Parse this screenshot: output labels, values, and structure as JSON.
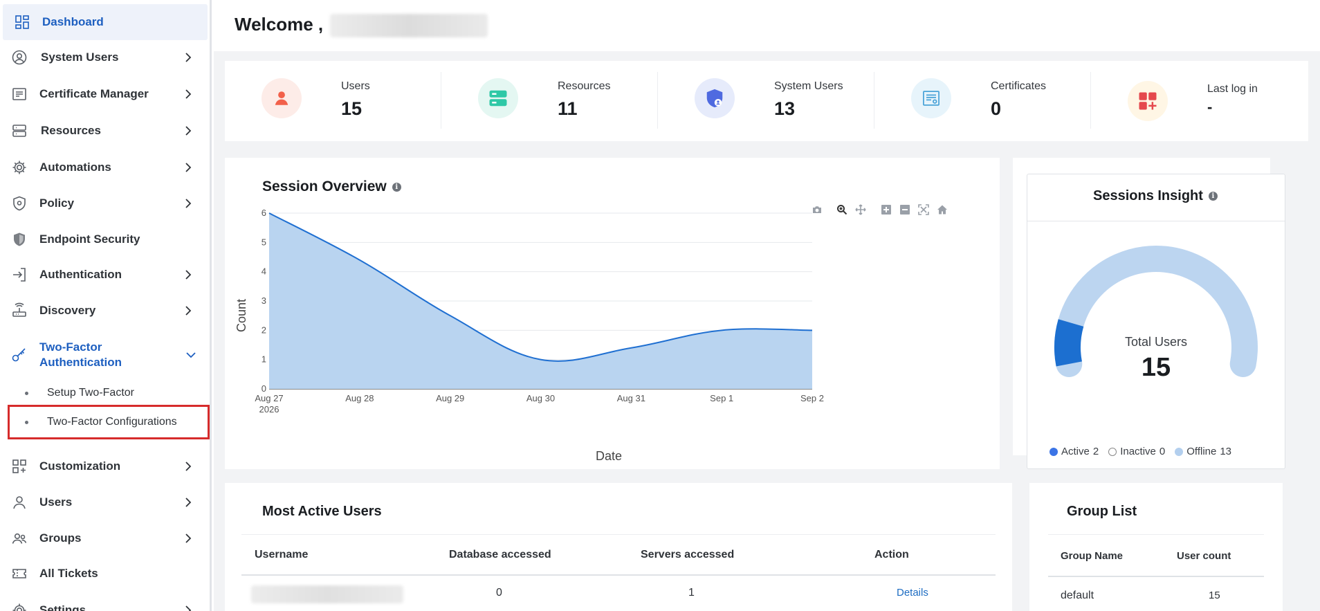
{
  "sidebar": {
    "items": [
      {
        "label": "Dashboard",
        "icon": "grid-icon"
      },
      {
        "label": "System Users",
        "icon": "user-circle-icon"
      },
      {
        "label": "Certificate Manager",
        "icon": "certificate-icon"
      },
      {
        "label": "Resources",
        "icon": "server-icon"
      },
      {
        "label": "Automations",
        "icon": "gear-icon"
      },
      {
        "label": "Policy",
        "icon": "shield-lock-icon"
      },
      {
        "label": "Endpoint Security",
        "icon": "shield-icon"
      },
      {
        "label": "Authentication",
        "icon": "login-icon"
      },
      {
        "label": "Discovery",
        "icon": "router-icon"
      },
      {
        "label": "Two-Factor\nAuthentication",
        "label_line1": "Two-Factor",
        "label_line2": "Authentication",
        "icon": "key-icon"
      },
      {
        "label": "Customization",
        "icon": "apps-add-icon"
      },
      {
        "label": "Users",
        "icon": "user-icon"
      },
      {
        "label": "Groups",
        "icon": "group-icon"
      },
      {
        "label": "All Tickets",
        "icon": "ticket-icon"
      },
      {
        "label": "Settings",
        "icon": "gear-icon"
      }
    ],
    "sub_items": [
      {
        "label": "Setup Two-Factor"
      },
      {
        "label": "Two-Factor Configurations"
      }
    ]
  },
  "header": {
    "welcome": "Welcome ,"
  },
  "stats": [
    {
      "title": "Users",
      "value": "15",
      "color": "#f2604a",
      "bg": "#fdece8"
    },
    {
      "title": "Resources",
      "value": "11",
      "color": "#2ec8a6",
      "bg": "#e4f7f2"
    },
    {
      "title": "System Users",
      "value": "13",
      "color": "#4f6ae0",
      "bg": "#e6ebfb"
    },
    {
      "title": "Certificates",
      "value": "0",
      "color": "#4aa3d8",
      "bg": "#e7f4fb"
    },
    {
      "title": "Last log in",
      "value": "-",
      "color": "#e5484d",
      "bg": "#fff6e5"
    }
  ],
  "session_overview": {
    "title": "Session Overview",
    "info": "i"
  },
  "chart_data": {
    "type": "area",
    "title": "Session Overview",
    "xlabel": "Date",
    "ylabel": "Count",
    "x": [
      "Aug 27\n2026",
      "Aug 28",
      "Aug 29",
      "Aug 30",
      "Aug 31",
      "Sep 1",
      "Sep 2"
    ],
    "x_ticks": [
      "Aug 27",
      "Aug 28",
      "Aug 29",
      "Aug 30",
      "Aug 31",
      "Sep 1",
      "Sep 2"
    ],
    "x_year": "2026",
    "values": [
      6,
      4.4,
      2.5,
      1,
      1.4,
      2,
      2
    ],
    "y_ticks": [
      "0",
      "1",
      "2",
      "3",
      "4",
      "5",
      "6"
    ],
    "ylim": [
      0,
      6
    ],
    "grid": true,
    "color": "#1f6fd1",
    "fill": "#b9d4f0"
  },
  "sessions_insight": {
    "title": "Sessions Insight",
    "info": "i",
    "center_label": "Total Users",
    "center_value": "15",
    "active_fraction": 0.1333,
    "legend": [
      {
        "label": "Active",
        "value": "2",
        "color": "#3b74e6"
      },
      {
        "label": "Inactive",
        "value": "0",
        "color": "#ffffff"
      },
      {
        "label": "Offline",
        "value": "13",
        "color": "#b3cfee"
      }
    ],
    "active_color": "#1c6fd0",
    "offline_color": "#bcd5f0"
  },
  "most_active": {
    "title": "Most Active Users",
    "columns": [
      "Username",
      "Database accessed",
      "Servers accessed",
      "Action"
    ],
    "rows": [
      {
        "database": "0",
        "servers": "1",
        "action": "Details"
      }
    ]
  },
  "group_list": {
    "title": "Group List",
    "columns": [
      "Group Name",
      "User count"
    ],
    "rows": [
      {
        "name": "default",
        "count": "15"
      }
    ]
  }
}
